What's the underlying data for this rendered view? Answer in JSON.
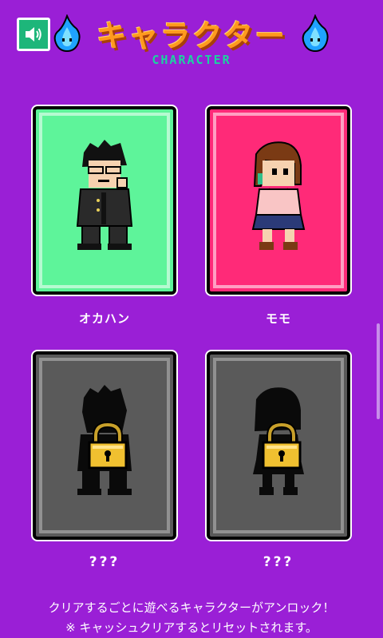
{
  "header": {
    "title": "キャラクター",
    "subtitle": "CHARACTER",
    "sound_icon": "speaker-volume-icon",
    "flame_icon": "blue-flame-icon"
  },
  "characters": [
    {
      "name": "オカハン",
      "status": "unlocked",
      "card_color": "#5ef49a"
    },
    {
      "name": "モモ",
      "status": "unlocked",
      "card_color": "#ff2a78"
    },
    {
      "name": "???",
      "status": "locked",
      "card_color": "#5a5a5a"
    },
    {
      "name": "???",
      "status": "locked",
      "card_color": "#5a5a5a"
    }
  ],
  "footer": {
    "note1": "クリアするごとに遊べるキャラクターがアンロック！",
    "note2": "※ キャッシュクリアするとリセットされます。"
  },
  "colors": {
    "background": "#9a1fd6",
    "title": "#ff9a1e",
    "subtitle": "#1bd3a0",
    "sound_button": "#1db67a"
  }
}
